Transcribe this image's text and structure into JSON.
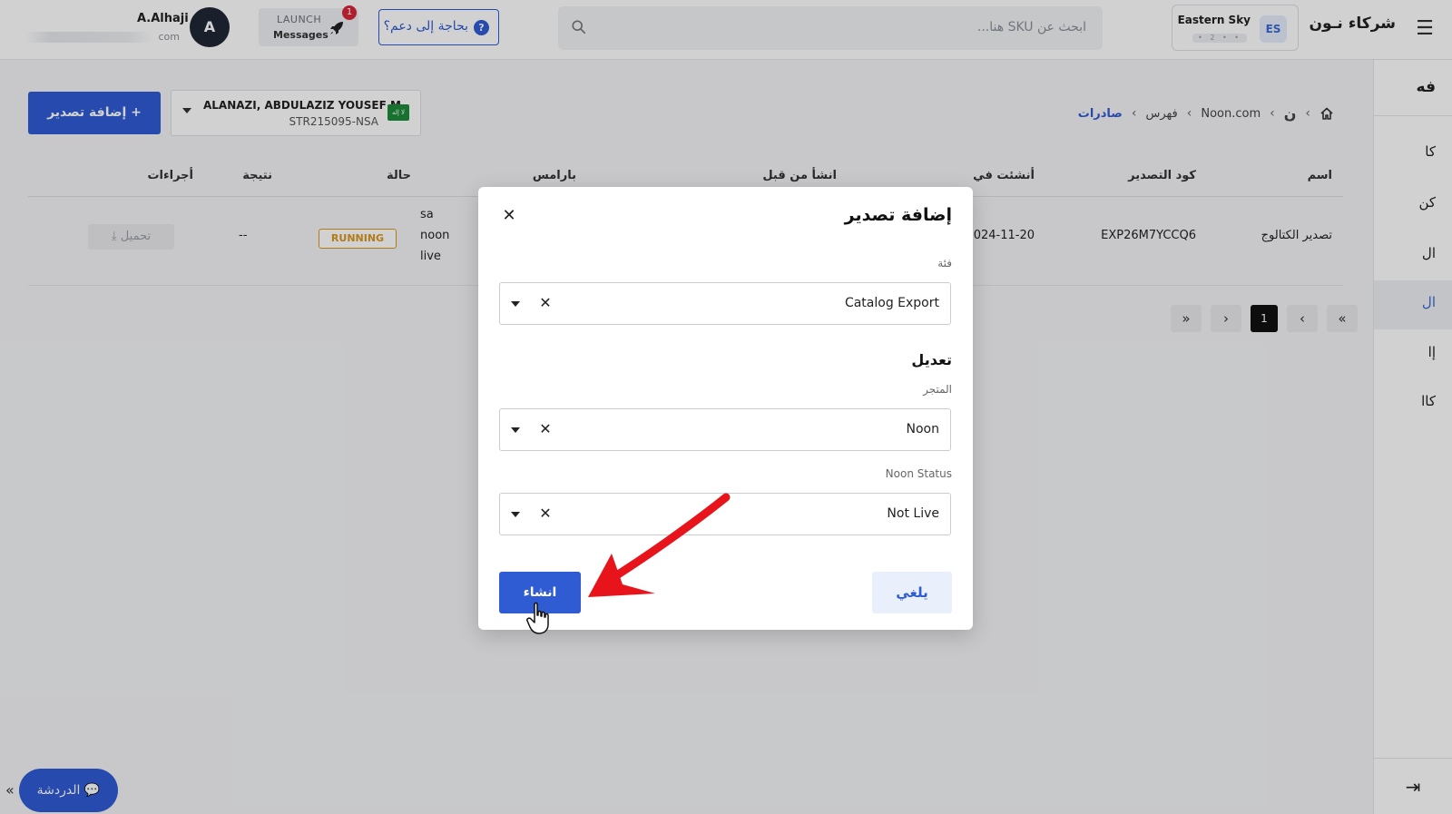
{
  "header": {
    "brand": "شركاء نـون",
    "store": {
      "name": "Eastern Sky",
      "initials": "ES",
      "sub": "• 2 • •"
    },
    "search_placeholder": "ابحث عن SKU هنا...",
    "help_label": "بحاجة إلى دعم؟",
    "launch": {
      "top": "LAUNCH",
      "bottom": "Messages",
      "badge": "1"
    },
    "user": {
      "initial": "A",
      "name": "A.Alhaji",
      "email_suffix": "com"
    }
  },
  "sidebar": {
    "items": [
      "فه",
      "كا",
      "كن",
      "ال",
      "ال",
      "إا",
      "كاا"
    ],
    "active_index": 4
  },
  "page": {
    "add_export_label": "+ إضافة تصدير",
    "partner": {
      "name": "ALANAZI, ABDULAZIZ YOUSEF M",
      "code": "STR215095-NSA",
      "flag": "لا إله"
    },
    "breadcrumb": {
      "site": "Noon.com",
      "catalog": "فهرس",
      "current": "صادرات",
      "noon_glyph": "ن"
    }
  },
  "table": {
    "headers": {
      "name": "اسم",
      "export_code": "كود التصدير",
      "created_at": "أنشئت في",
      "created_by": "انشأ من قبل",
      "params": "بارامس",
      "status": "حالة",
      "result": "نتيجة",
      "actions": "أجراءات"
    },
    "rows": [
      {
        "name": "تصدير الكتالوج",
        "export_code": "EXP26M7YCCQ6",
        "created_at": "2024-11-20",
        "params": [
          "sa",
          "noon",
          "live"
        ],
        "status": "RUNNING",
        "result": "--",
        "action": "⤓ تحميل"
      }
    ]
  },
  "pagination": {
    "current": "1",
    "first": "«",
    "prev": "‹",
    "next": "›",
    "last": "»"
  },
  "modal": {
    "title": "إضافة تصدير",
    "category_label": "فئة",
    "category_value": "Catalog Export",
    "section_title": "تعديل",
    "store_label": "المتجر",
    "store_value": "Noon",
    "status_label": "Noon Status",
    "status_value": "Not Live",
    "create_label": "انشاء",
    "cancel_label": "يلغي"
  },
  "chat": {
    "label": "الدردشة",
    "expand": "«"
  },
  "colors": {
    "primary": "#2f5bd3",
    "running": "#d9971f",
    "annotation_arrow": "#e8141b"
  }
}
